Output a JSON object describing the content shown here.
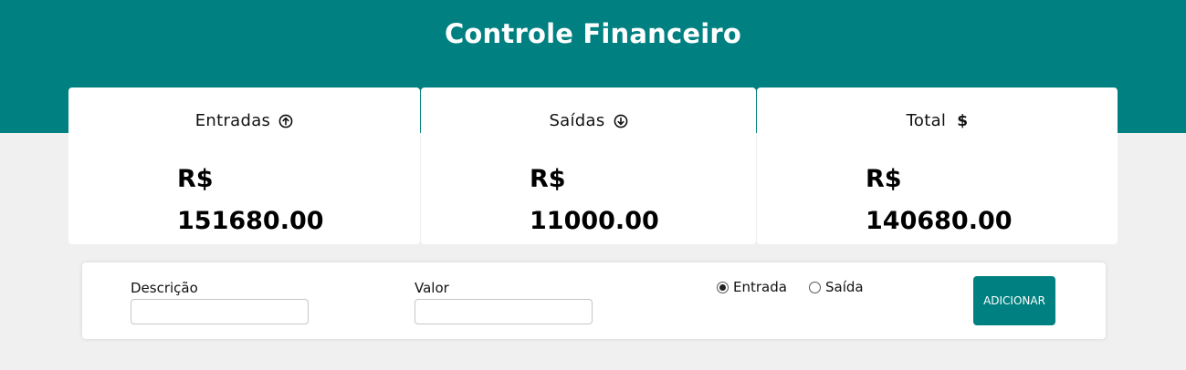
{
  "header": {
    "title": "Controle Financeiro",
    "background_color": "#008080"
  },
  "cards": {
    "entradas": {
      "label": "Entradas",
      "icon": "arrow-up-circle-icon",
      "currency": "R$",
      "amount": "151680.00"
    },
    "saidas": {
      "label": "Saídas",
      "icon": "arrow-down-circle-icon",
      "currency": "R$",
      "amount": "11000.00"
    },
    "total": {
      "label": "Total",
      "icon_symbol": "$",
      "currency": "R$",
      "amount": "140680.00"
    }
  },
  "form": {
    "description_label": "Descrição",
    "description_value": "",
    "value_label": "Valor",
    "value_value": "",
    "radio_entrada_label": "Entrada",
    "radio_entrada_checked": true,
    "radio_saida_label": "Saída",
    "radio_saida_checked": false,
    "add_button_label": "ADICIONAR"
  }
}
